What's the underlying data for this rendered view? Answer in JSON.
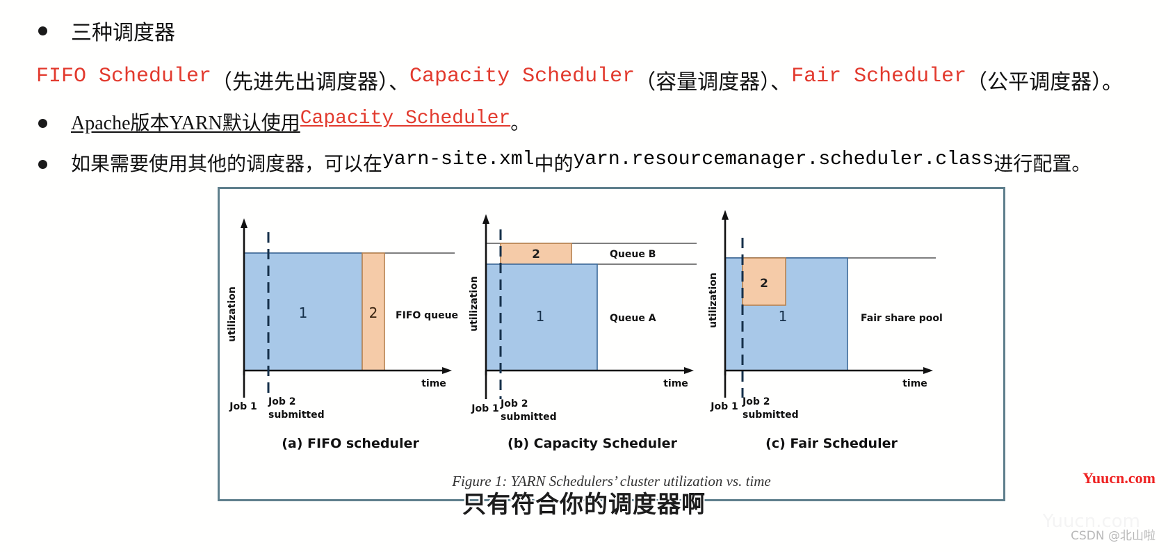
{
  "slide": {
    "bullets": [
      {
        "id": "b1",
        "text": "三种调度器"
      },
      {
        "id": "b3",
        "prefix": "Apache版本YARN默认使用",
        "link": "Capacity Scheduler",
        "suffix": "。"
      },
      {
        "id": "b4",
        "p1": "如果需要使用其他的调度器，可以在",
        "code1": "yarn-site.xml",
        "p2": "中的",
        "code2": "yarn.resourcemanager.scheduler.class",
        "p3": "进行配置。"
      }
    ],
    "scheduler_line": {
      "s1": "FIFO Scheduler",
      "t1": "（先进先出调度器）、",
      "s2": "Capacity Scheduler",
      "t2": "（容量调度器）、",
      "s3": "Fair Scheduler",
      "t3": "（公平调度器）。"
    },
    "accent_red": "#e23a2e",
    "overlay_subtitle": "只有符合你的调度器啊"
  },
  "figure": {
    "caption": "Figure 1: YARN Schedulers’ cluster utilization vs. time",
    "border_color": "#5f7f8c",
    "colors": {
      "job1_fill": "#a8c8e8",
      "job1_stroke": "#4f7aa8",
      "job2_fill": "#f5cba8",
      "job2_stroke": "#c58a5a",
      "axis": "#1a1a1a"
    },
    "axis_labels": {
      "y": "utilization",
      "x": "time"
    },
    "tick_labels": {
      "job1": "Job 1",
      "job2_l1": "Job 2",
      "job2_l2": "submitted"
    },
    "panels": [
      {
        "id": "a",
        "caption": "(a) FIFO scheduler",
        "queue_label": "FIFO queue",
        "job1": "1",
        "job2": "2"
      },
      {
        "id": "b",
        "caption": "(b) Capacity Scheduler",
        "queue_label_top": "Queue B",
        "queue_label_bottom": "Queue A",
        "job1": "1",
        "job2": "2"
      },
      {
        "id": "c",
        "caption": "(c) Fair Scheduler",
        "queue_label": "Fair share pool",
        "job1": "1",
        "job2": "2"
      }
    ]
  },
  "chart_data": {
    "type": "area",
    "title": "Figure 1: YARN Schedulers’ cluster utilization vs. time",
    "xlabel": "time",
    "ylabel": "utilization",
    "grid": false,
    "legend": "inline-labels",
    "panels": [
      {
        "name": "(a) FIFO scheduler",
        "xlim": [
          0,
          10
        ],
        "ylim": [
          0,
          1.2
        ],
        "capacity_line": 1.0,
        "job_submit_marker_x": 0.6,
        "blocks": [
          {
            "label": "1",
            "x0": 0.0,
            "x1": 5.0,
            "y0": 0.0,
            "y1": 1.0,
            "series": "Job 1"
          },
          {
            "label": "2",
            "x0": 5.0,
            "x1": 6.0,
            "y0": 0.0,
            "y1": 1.0,
            "series": "Job 2"
          }
        ],
        "annotations": [
          "FIFO queue"
        ]
      },
      {
        "name": "(b) Capacity Scheduler",
        "xlim": [
          0,
          10
        ],
        "ylim": [
          0,
          1.2
        ],
        "capacity_line": 1.0,
        "queue_split": 0.7,
        "job_submit_marker_x": 0.6,
        "blocks": [
          {
            "label": "1",
            "x0": 0.0,
            "x1": 5.0,
            "y0": 0.0,
            "y1": 0.7,
            "series": "Queue A / Job 1"
          },
          {
            "label": "2",
            "x0": 0.6,
            "x1": 3.1,
            "y0": 0.7,
            "y1": 1.0,
            "series": "Queue B / Job 2"
          }
        ],
        "annotations": [
          "Queue B",
          "Queue A"
        ]
      },
      {
        "name": "(c) Fair Scheduler",
        "xlim": [
          0,
          10
        ],
        "ylim": [
          0,
          1.2
        ],
        "capacity_line": 1.0,
        "job_submit_marker_x": 0.6,
        "blocks": [
          {
            "label": "1",
            "x0": 0.0,
            "x1": 5.2,
            "y0": 0.0,
            "y1": 1.0,
            "series": "Job 1"
          },
          {
            "label": "2",
            "x0": 0.6,
            "x1": 2.3,
            "y0": 0.55,
            "y1": 1.0,
            "series": "Job 2"
          }
        ],
        "annotations": [
          "Fair share pool"
        ]
      }
    ]
  },
  "watermarks": {
    "yuucn": "Yuucn.com",
    "csdn": "CSDN @北山啦"
  }
}
